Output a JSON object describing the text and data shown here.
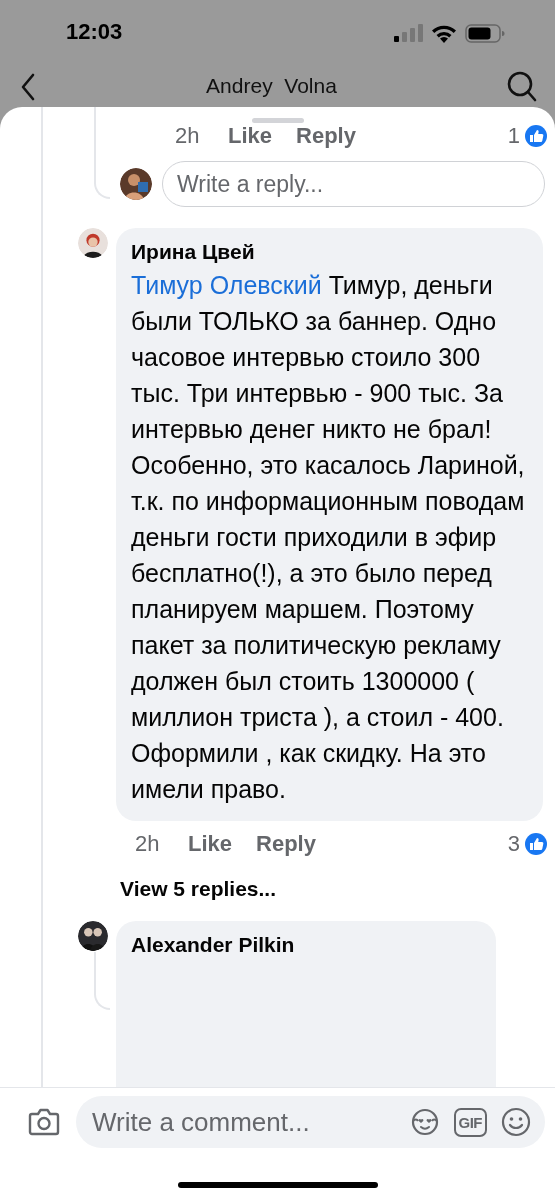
{
  "status_bar": {
    "time": "12:03"
  },
  "header": {
    "title": "Andrey  Volna"
  },
  "previous_reply": {
    "time": "2h",
    "like": "Like",
    "reply": "Reply",
    "reactions": "1"
  },
  "reply_box": {
    "placeholder": "Write a reply..."
  },
  "comments": [
    {
      "author": "Ирина Цвей",
      "mention": "Тимур Олевский",
      "text": "Тимур, деньги были ТОЛЬКО за баннер. Одно часовое интервью стоило 300 тыс. Три интервью - 900 тыс. За интервью денег никто не брал! Особенно, это касалось Лариной, т.к. по информационным поводам деньги гости приходили в эфир бесплатно(!), а это было перед планируем маршем. Поэтому пакет за политическую рекламу должен был стоить 1300000 ( миллион триста ), а стоил - 400. Оформили , как скидку. На это имели право.",
      "time": "2h",
      "like": "Like",
      "reply": "Reply",
      "reactions": "3",
      "view_replies": "View 5 replies..."
    },
    {
      "author": "Alexander Pilkin"
    }
  ],
  "composer": {
    "placeholder": "Write a comment...",
    "gif": "GIF"
  }
}
